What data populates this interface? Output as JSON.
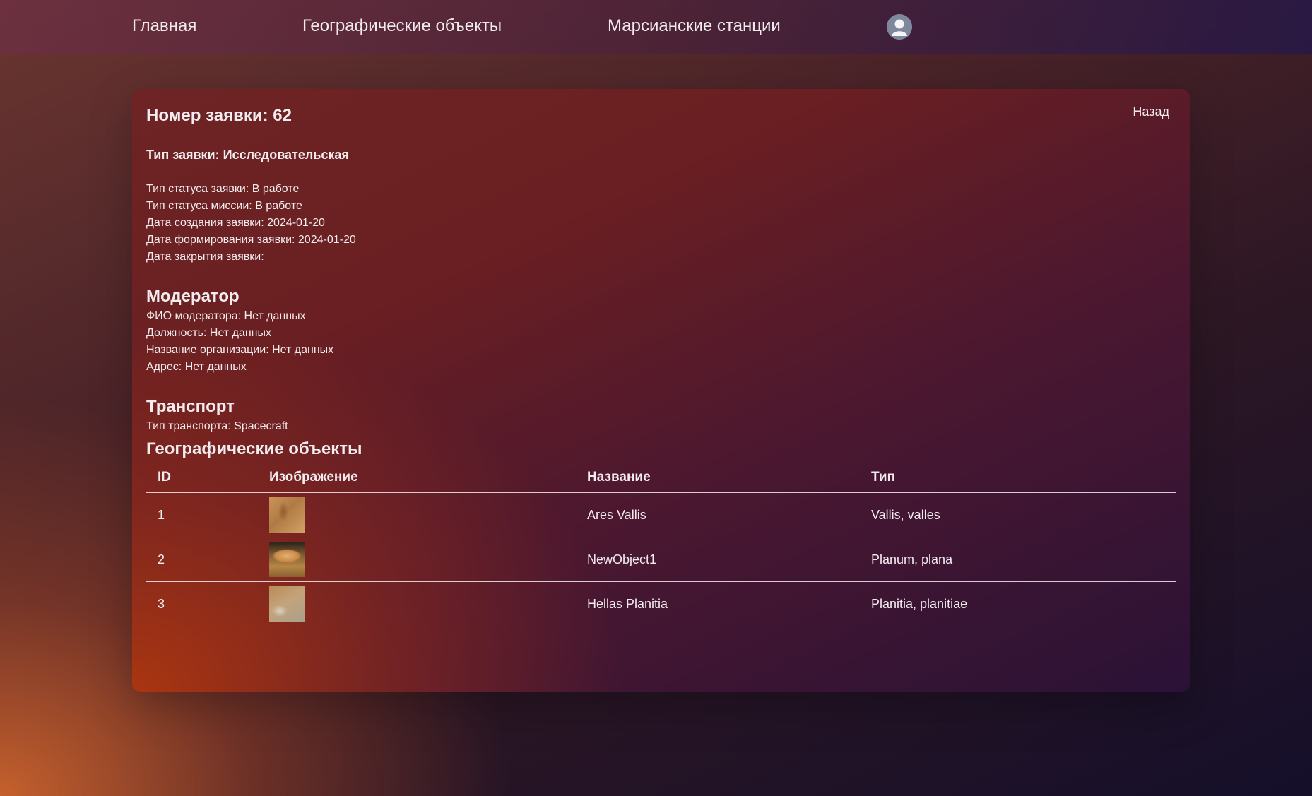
{
  "nav": {
    "home": "Главная",
    "geo_objects": "Географические объекты",
    "stations": "Марсианские станции",
    "avatar_icon": "user-avatar-icon"
  },
  "order": {
    "title": "Номер заявки: 62",
    "type": "Тип заявки: Исследовательская",
    "back_label": "Назад",
    "details": [
      "Тип статуса заявки: В работе",
      "Тип статуса миссии: В работе",
      "Дата создания заявки: 2024-01-20",
      "Дата формирования заявки: 2024-01-20",
      "Дата закрытия заявки:"
    ]
  },
  "moderator": {
    "title": "Модератор",
    "fields": [
      "ФИО модератора: Нет данных",
      "Должность: Нет данных",
      "Название организации: Нет данных",
      "Адрес: Нет данных"
    ]
  },
  "transport": {
    "title": "Транспорт",
    "type": "Тип транспорта: Spacecraft"
  },
  "geo": {
    "title": "Географические объекты",
    "columns": [
      "ID",
      "Изображение",
      "Название",
      "Тип"
    ],
    "rows": [
      {
        "id": "1",
        "name": "Ares Vallis",
        "type": "Vallis, valles"
      },
      {
        "id": "2",
        "name": "NewObject1",
        "type": "Planum, plana"
      },
      {
        "id": "3",
        "name": "Hellas Planitia",
        "type": "Planitia, planitiae"
      }
    ]
  },
  "colors": {
    "accent_text": "#f2ecef",
    "card_base": "#6a1f22",
    "topbar": "#3a1e4a"
  }
}
